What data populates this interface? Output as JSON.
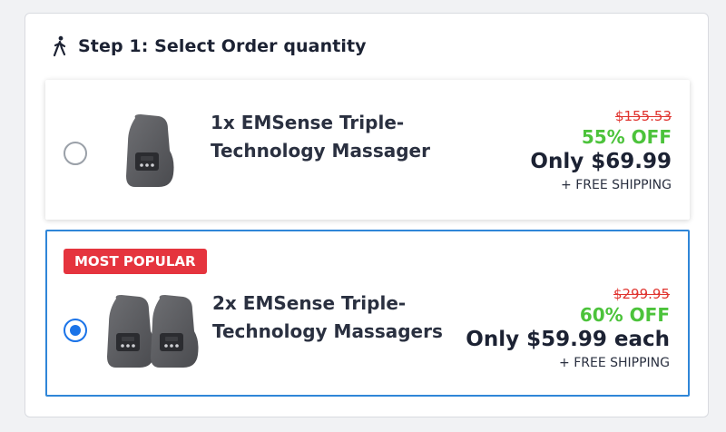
{
  "step": {
    "icon": "walking-person-icon",
    "title": "Step 1: Select Order quantity"
  },
  "options": [
    {
      "selected": false,
      "badge": "",
      "name": "1x EMSense Triple-Technology Massager",
      "original_price": "$155.53",
      "discount": "55% OFF",
      "price": "Only $69.99",
      "shipping": "+ FREE SHIPPING",
      "image_icon": "massager-device-icon",
      "quantity_images": 1
    },
    {
      "selected": true,
      "badge": "MOST POPULAR",
      "name": "2x EMSense Triple-Technology Massagers",
      "original_price": "$299.95",
      "discount": "60% OFF",
      "price": "Only $59.99 each",
      "shipping": "+ FREE SHIPPING",
      "image_icon": "massager-device-icon",
      "quantity_images": 2
    }
  ],
  "colors": {
    "accent": "#2f86d8",
    "badge": "#e5343e",
    "discount": "#4cc33b",
    "strike_price": "#e0342f"
  }
}
